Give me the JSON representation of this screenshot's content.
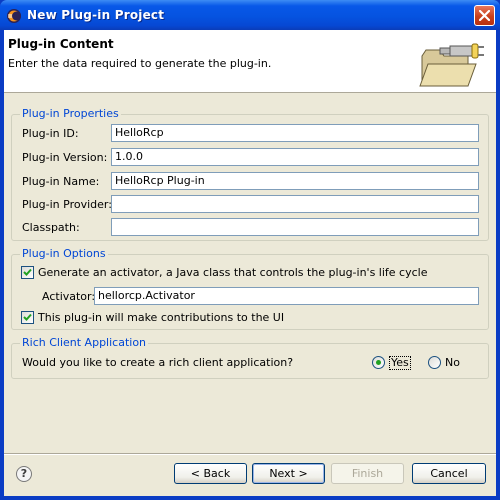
{
  "window": {
    "title": "New Plug-in Project",
    "close_glyph": "×"
  },
  "header": {
    "title": "Plug-in Content",
    "description": "Enter the data required to generate the plug-in.",
    "icon": "folder-plugin-icon"
  },
  "properties": {
    "group_title": "Plug-in Properties",
    "id_label": "Plug-in ID:",
    "id_value": "HelloRcp",
    "version_label": "Plug-in Version:",
    "version_value": "1.0.0",
    "name_label": "Plug-in Name:",
    "name_value": "HelloRcp Plug-in",
    "provider_label": "Plug-in Provider:",
    "provider_value": "",
    "classpath_label": "Classpath:",
    "classpath_value": ""
  },
  "options": {
    "group_title": "Plug-in Options",
    "activator_check_label": "Generate an activator, a Java class that controls the plug-in's life cycle",
    "activator_checked": true,
    "activator_label": "Activator:",
    "activator_value": "hellorcp.Activator",
    "ui_check_label": "This plug-in will make contributions to the UI",
    "ui_checked": true
  },
  "rcp": {
    "group_title": "Rich Client Application",
    "question": "Would you like to create a rich client application?",
    "yes_label": "Yes",
    "no_label": "No",
    "selected": "Yes"
  },
  "footer": {
    "help_glyph": "?",
    "back_label": "< Back",
    "next_label": "Next >",
    "finish_label": "Finish",
    "cancel_label": "Cancel"
  },
  "colors": {
    "title_bar": "#0553e0",
    "group_title": "#0046d5",
    "dialog_bg": "#ece9d8",
    "radio_dot": "#21a121"
  }
}
